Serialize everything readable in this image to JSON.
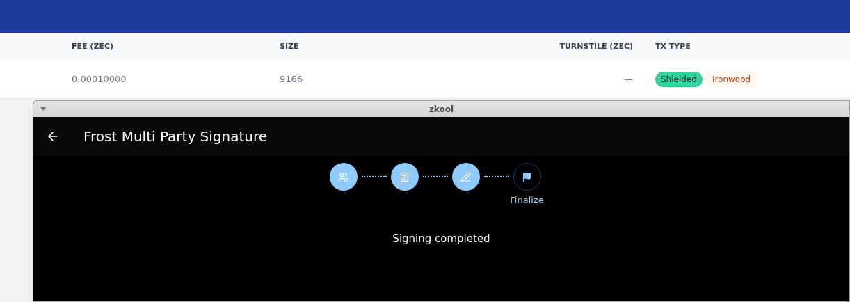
{
  "table": {
    "columns": [
      "FEE (ZEC)",
      "SIZE",
      "TURNSTILE (ZEC)",
      "TX TYPE"
    ],
    "rows": [
      {
        "fee": "0.00010000",
        "size": "9166",
        "turnstile": "—",
        "tags": [
          {
            "label": "Shielded",
            "kind": "solid"
          },
          {
            "label": "Ironwood",
            "kind": "soft"
          }
        ]
      }
    ]
  },
  "window": {
    "title": "zkool",
    "app_bar": {
      "title": "Frost Multi Party Signature"
    },
    "steps": [
      {
        "kind": "participants",
        "completed": true
      },
      {
        "kind": "receipt",
        "completed": true
      },
      {
        "kind": "sign",
        "completed": true
      },
      {
        "kind": "finalize",
        "completed": false,
        "label": "Finalize"
      }
    ],
    "message": "Signing completed"
  }
}
